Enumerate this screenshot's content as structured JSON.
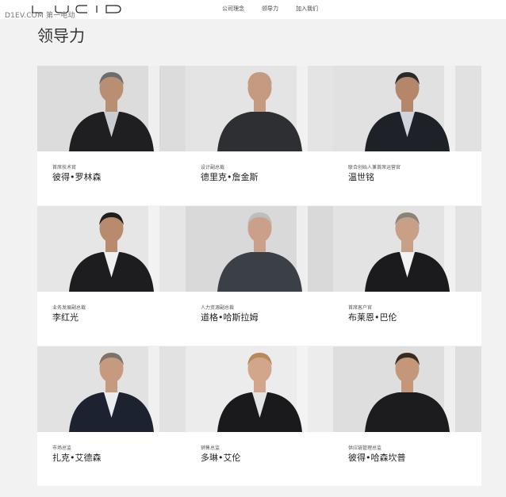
{
  "watermark": "D1EV.COM 第一电动",
  "brand": {
    "logo_text": "LUCID"
  },
  "nav": {
    "items": [
      {
        "label": "公司理念"
      },
      {
        "label": "领导力"
      },
      {
        "label": "加入我们"
      }
    ]
  },
  "page": {
    "title": "领导力"
  },
  "leaders": [
    {
      "role": "首席技术官",
      "name": "彼得•罗林森",
      "suit": "#1f1f22",
      "shirt": "#c9cdd2",
      "skin": "#b98f73",
      "hair": "#6d6d6d",
      "bg": "#dcdcdc"
    },
    {
      "role": "设计副总裁",
      "name": "德里克•詹金斯",
      "suit": "#2e2f33",
      "shirt": "#2e2f33",
      "skin": "#c49b80",
      "hair": "#c49b80",
      "bg": "#e4e4e4"
    },
    {
      "role": "联合创始人兼首席运营官",
      "name": "温世铭",
      "suit": "#1e2128",
      "shirt": "#cfd3da",
      "skin": "#b4876a",
      "hair": "#2a2a2a",
      "bg": "#e1e1e1"
    },
    {
      "role": "业务发展副总裁",
      "name": "李红光",
      "suit": "#1d1d20",
      "shirt": "#f0f0f0",
      "skin": "#b88b6c",
      "hair": "#1f1f1f",
      "bg": "#e6e6e6"
    },
    {
      "role": "人力资源副总裁",
      "name": "道格•哈斯拉姆",
      "suit": "#3b4047",
      "shirt": "#3b4047",
      "skin": "#caa08a",
      "hair": "#bdbdbd",
      "bg": "#d9d9d9"
    },
    {
      "role": "首席客户官",
      "name": "布莱恩•巴伦",
      "suit": "#1b1b1e",
      "shirt": "#f2f2f2",
      "skin": "#c8a088",
      "hair": "#8b8378",
      "bg": "#e3e3e3"
    },
    {
      "role": "市场总监",
      "name": "扎克•艾德森",
      "suit": "#1c2230",
      "shirt": "#e9ecf0",
      "skin": "#c59a7e",
      "hair": "#7d7368",
      "bg": "#e2e2e2"
    },
    {
      "role": "销售总监",
      "name": "多琳•艾伦",
      "suit": "#1a1a1c",
      "shirt": "#e4e4e4",
      "skin": "#d1a68b",
      "hair": "#b88a55",
      "bg": "#ececec"
    },
    {
      "role": "供应链管理总监",
      "name": "彼得•哈森坎普",
      "suit": "#1c1c1e",
      "shirt": "#1c1c1e",
      "skin": "#c49778",
      "hair": "#3a2b20",
      "bg": "#dedede"
    }
  ]
}
